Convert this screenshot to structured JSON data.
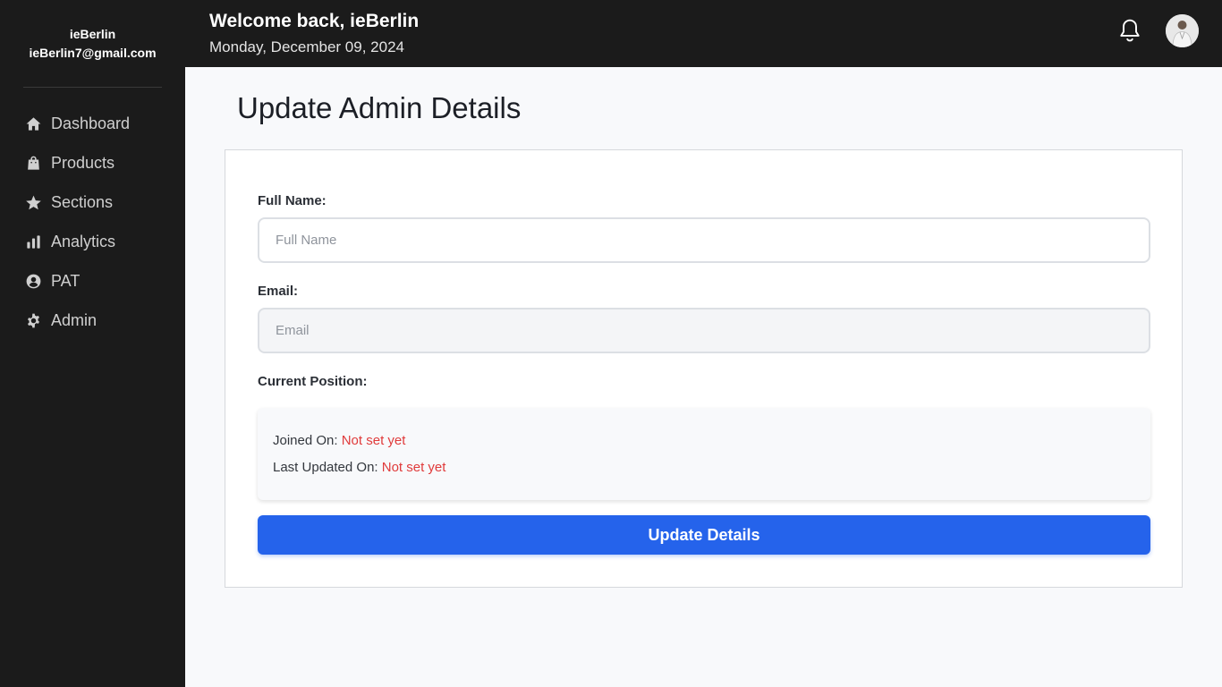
{
  "sidebar": {
    "username": "ieBerlin",
    "email": "ieBerlin7@gmail.com",
    "items": [
      {
        "label": "Dashboard",
        "icon": "home-icon"
      },
      {
        "label": "Products",
        "icon": "shopping-bag-icon"
      },
      {
        "label": "Sections",
        "icon": "star-icon"
      },
      {
        "label": "Analytics",
        "icon": "bar-chart-icon"
      },
      {
        "label": "PAT",
        "icon": "user-circle-icon"
      },
      {
        "label": "Admin",
        "icon": "gear-icon"
      }
    ]
  },
  "header": {
    "welcome": "Welcome back, ieBerlin",
    "date": "Monday, December 09, 2024",
    "bell_icon": "bell-icon",
    "avatar_icon": "avatar"
  },
  "main": {
    "title": "Update Admin Details",
    "form": {
      "full_name_label": "Full Name:",
      "full_name_placeholder": "Full Name",
      "full_name_value": "",
      "email_label": "Email:",
      "email_placeholder": "Email",
      "email_value": "",
      "position_label": "Current Position:",
      "joined_label": "Joined On:",
      "joined_value": "Not set yet",
      "updated_label": "Last Updated On:",
      "updated_value": "Not set yet",
      "submit_label": "Update Details"
    }
  },
  "colors": {
    "sidebar_bg": "#1b1b1b",
    "accent": "#2563eb",
    "not_set": "#e03b3b"
  }
}
